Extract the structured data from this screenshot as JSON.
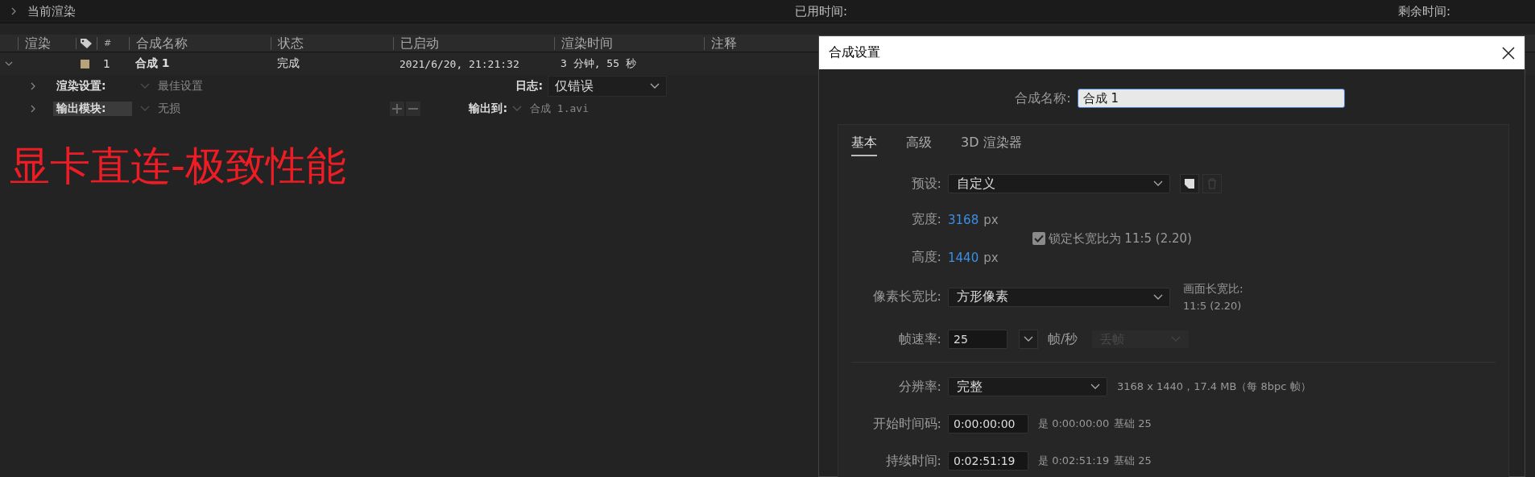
{
  "top_bar": {
    "expanded": false,
    "label": "当前渲染",
    "elapsed_label": "已用时间:",
    "remaining_label": "剩余时间:"
  },
  "queue": {
    "columns": [
      "渲染",
      "#",
      "合成名称",
      "状态",
      "已启动",
      "渲染时间",
      "注释"
    ],
    "rows": [
      {
        "expanded": true,
        "color": "#b8a27c",
        "number": "1",
        "name": "合成 1",
        "status": "完成",
        "started": "2021/6/20, 21:21:32",
        "render_time": "3 分钟, 55 秒",
        "render_settings": {
          "expanded": false,
          "label": "渲染设置:",
          "value": "最佳设置",
          "log_label": "日志:",
          "log_value": "仅错误"
        },
        "output_module": {
          "expanded": false,
          "label": "输出模块:",
          "value": "无损",
          "output_label": "输出到:",
          "output_value": "合成 1.avi"
        }
      }
    ]
  },
  "overlay_text": "显卡直连-极致性能",
  "dialog": {
    "title": "合成设置",
    "name_label": "合成名称:",
    "name_value": "合成 1",
    "tabs": [
      {
        "label": "基本",
        "selected": true
      },
      {
        "label": "高级",
        "selected": false
      },
      {
        "label": "3D 渲染器",
        "selected": false
      }
    ],
    "preset": {
      "label": "预设:",
      "value": "自定义"
    },
    "width": {
      "label": "宽度:",
      "value": "3168",
      "unit": "px"
    },
    "height": {
      "label": "高度:",
      "value": "1440",
      "unit": "px"
    },
    "lock_aspect": {
      "label": "锁定长宽比为 11:5 (2.20)",
      "checked": true
    },
    "pixel_aspect": {
      "label": "像素长宽比:",
      "value": "方形像素"
    },
    "frame_aspect": {
      "label": "画面长宽比:",
      "value": "11:5 (2.20)"
    },
    "frame_rate": {
      "label": "帧速率:",
      "value": "25",
      "unit": "帧/秒",
      "drop_frame": {
        "value": "丢帧",
        "disabled": true
      }
    },
    "resolution": {
      "label": "分辨率:",
      "value": "完整",
      "info": "3168 x 1440，17.4 MB（每 8bpc 帧）"
    },
    "start_timecode": {
      "label": "开始时间码:",
      "value": "0:00:00:00",
      "info": "是 0:00:00:00",
      "base": "基础 25"
    },
    "duration": {
      "label": "持续时间:",
      "value": "0:02:51:19",
      "info": "是 0:02:51:19",
      "base": "基础 25"
    }
  }
}
